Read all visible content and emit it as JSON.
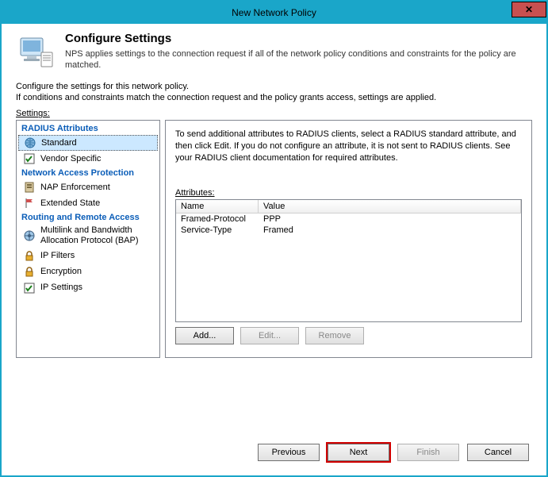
{
  "window": {
    "title": "New Network Policy",
    "close": "✕"
  },
  "header": {
    "title": "Configure Settings",
    "desc": "NPS applies settings to the connection request if all of the network policy conditions and constraints for the policy are matched."
  },
  "intro": {
    "line1": "Configure the settings for this network policy.",
    "line2": "If conditions and constraints match the connection request and the policy grants access, settings are applied."
  },
  "settings_label": "Settings:",
  "sidebar": {
    "cat_radius": "RADIUS Attributes",
    "standard": "Standard",
    "vendor": "Vendor Specific",
    "cat_nap": "Network Access Protection",
    "nap": "NAP Enforcement",
    "extstate": "Extended State",
    "cat_routing": "Routing and Remote Access",
    "bap": "Multilink and Bandwidth Allocation Protocol (BAP)",
    "ipfilters": "IP Filters",
    "encryption": "Encryption",
    "ipsettings": "IP Settings"
  },
  "content": {
    "desc": "To send additional attributes to RADIUS clients, select a RADIUS standard attribute, and then click Edit. If you do not configure an attribute, it is not sent to RADIUS clients. See your RADIUS client documentation for required attributes.",
    "attr_label": "Attributes:",
    "col_name": "Name",
    "col_value": "Value",
    "rows": [
      {
        "name": "Framed-Protocol",
        "value": "PPP"
      },
      {
        "name": "Service-Type",
        "value": "Framed"
      }
    ],
    "add": "Add...",
    "edit": "Edit...",
    "remove": "Remove"
  },
  "footer": {
    "previous": "Previous",
    "next": "Next",
    "finish": "Finish",
    "cancel": "Cancel"
  }
}
